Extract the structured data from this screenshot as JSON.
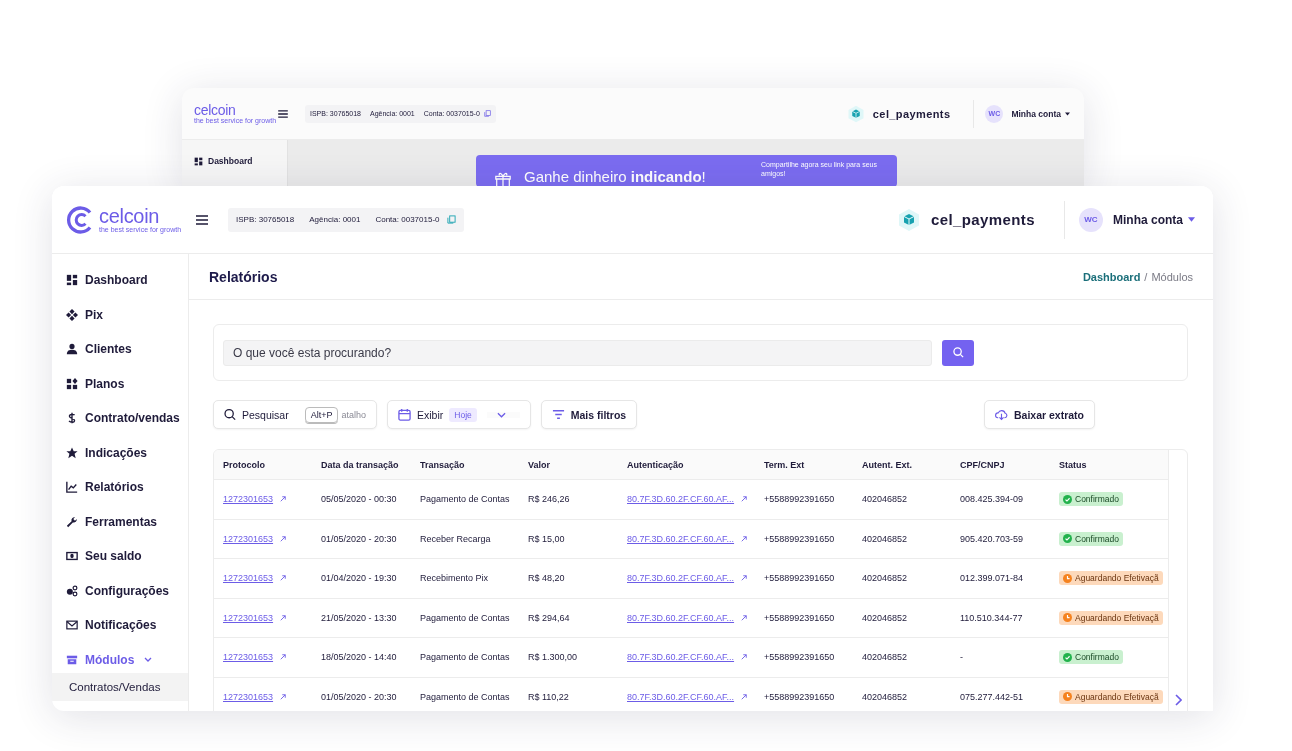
{
  "back_window": {
    "logo": "celcoin",
    "tagline": "the best service for growth",
    "account_info": [
      "ISPB: 30765018",
      "Agência: 0001",
      "Conta: 0037015-0"
    ],
    "workspace": "cel_payments",
    "avatar": "WC",
    "account_menu": "Minha conta",
    "sidebar": {
      "items": [
        {
          "label": "Dashboard",
          "selected": false
        }
      ]
    },
    "banner": {
      "title": "Ganhe dinheiro **indicando**!",
      "text": "Compartilhe agora seu link para seus amigos!"
    }
  },
  "window": {
    "logo": "celcoin",
    "tagline": "the best service for growth",
    "account_info": [
      "ISPB: 30765018",
      "Agência: 0001",
      "Conta: 0037015-0"
    ],
    "workspace": "cel_payments",
    "avatar": "WC",
    "account_menu": "Minha conta",
    "sidebar": {
      "items": [
        {
          "label": "Dashboard",
          "selected": false
        },
        {
          "label": "Pix",
          "selected": false
        },
        {
          "label": "Clientes",
          "selected": false
        },
        {
          "label": "Planos",
          "selected": false
        },
        {
          "label": "Contrato/vendas",
          "selected": false
        },
        {
          "label": "Indicações",
          "selected": false
        },
        {
          "label": "Relatórios",
          "selected": false
        },
        {
          "label": "Ferramentas",
          "selected": false
        },
        {
          "label": "Seu saldo",
          "selected": false
        },
        {
          "label": "Configurações",
          "selected": false
        },
        {
          "label": "Notificações",
          "selected": false
        },
        {
          "label": "Módulos",
          "selected": true,
          "expanded": true,
          "children": [
            {
              "label": "Contratos/Vendas",
              "selected": false
            }
          ]
        }
      ]
    },
    "page_title": "Relatórios",
    "breadcrumb": [
      {
        "label": "Dashboard",
        "current": false
      },
      {
        "label": "Módulos",
        "current": true
      }
    ],
    "breadcrumb_separator": "/",
    "search": {
      "placeholder": "O que você esta procurando?"
    },
    "toolbar": {
      "search_label": "Pesquisar",
      "shortcut": "Alt+P",
      "shortcut_hint": "atalho",
      "display_label": "Exibir",
      "display_value": "Hoje",
      "more_filters": "Mais filtros",
      "download": "Baixar extrato"
    },
    "table": {
      "columns": [
        "Protocolo",
        "Data da transação",
        "Transação",
        "Valor",
        "Autenticação",
        "Term. Ext",
        "Autent. Ext.",
        "CPF/CNPJ",
        "Status"
      ],
      "rows": [
        {
          "protocol": "1272301653",
          "date": "05/05/2020 - 00:30",
          "transaction": "Pagamento de Contas",
          "value": "R$ 246,26",
          "authentication": "80.7F.3D.60.2F.CF.60.AF...",
          "term_ext": "+5588992391650",
          "autent_ext": "402046852",
          "cpf_cnpj": "008.425.394-09",
          "status": {
            "label": "Confirmado",
            "kind": "confirmed"
          }
        },
        {
          "protocol": "1272301653",
          "date": "01/05/2020 - 20:30",
          "transaction": "Receber Recarga",
          "value": "R$ 15,00",
          "authentication": "80.7F.3D.60.2F.CF.60.AF...",
          "term_ext": "+5588992391650",
          "autent_ext": "402046852",
          "cpf_cnpj": "905.420.703-59",
          "status": {
            "label": "Confirmado",
            "kind": "confirmed"
          }
        },
        {
          "protocol": "1272301653",
          "date": "01/04/2020 - 19:30",
          "transaction": "Recebimento Pix",
          "value": "R$ 48,20",
          "authentication": "80.7F.3D.60.2F.CF.60.AF...",
          "term_ext": "+5588992391650",
          "autent_ext": "402046852",
          "cpf_cnpj": "012.399.071-84",
          "status": {
            "label": "Aguardando Efetivaçã",
            "kind": "pending"
          }
        },
        {
          "protocol": "1272301653",
          "date": "21/05/2020 - 13:30",
          "transaction": "Pagamento de Contas",
          "value": "R$ 294,64",
          "authentication": "80.7F.3D.60.2F.CF.60.AF...",
          "term_ext": "+5588992391650",
          "autent_ext": "402046852",
          "cpf_cnpj": "110.510.344-77",
          "status": {
            "label": "Aguardando Efetivaçã",
            "kind": "pending"
          }
        },
        {
          "protocol": "1272301653",
          "date": "18/05/2020 - 14:40",
          "transaction": "Pagamento de Contas",
          "value": "R$ 1.300,00",
          "authentication": "80.7F.3D.60.2F.CF.60.AF...",
          "term_ext": "+5588992391650",
          "autent_ext": "402046852",
          "cpf_cnpj": "-",
          "status": {
            "label": "Confirmado",
            "kind": "confirmed"
          }
        },
        {
          "protocol": "1272301653",
          "date": "01/05/2020 - 20:30",
          "transaction": "Pagamento de Contas",
          "value": "R$ 110,22",
          "authentication": "80.7F.3D.60.2F.CF.60.AF...",
          "term_ext": "+5588992391650",
          "autent_ext": "402046852",
          "cpf_cnpj": "075.277.442-51",
          "status": {
            "label": "Aguardando Efetivaçã",
            "kind": "pending"
          }
        }
      ]
    }
  }
}
